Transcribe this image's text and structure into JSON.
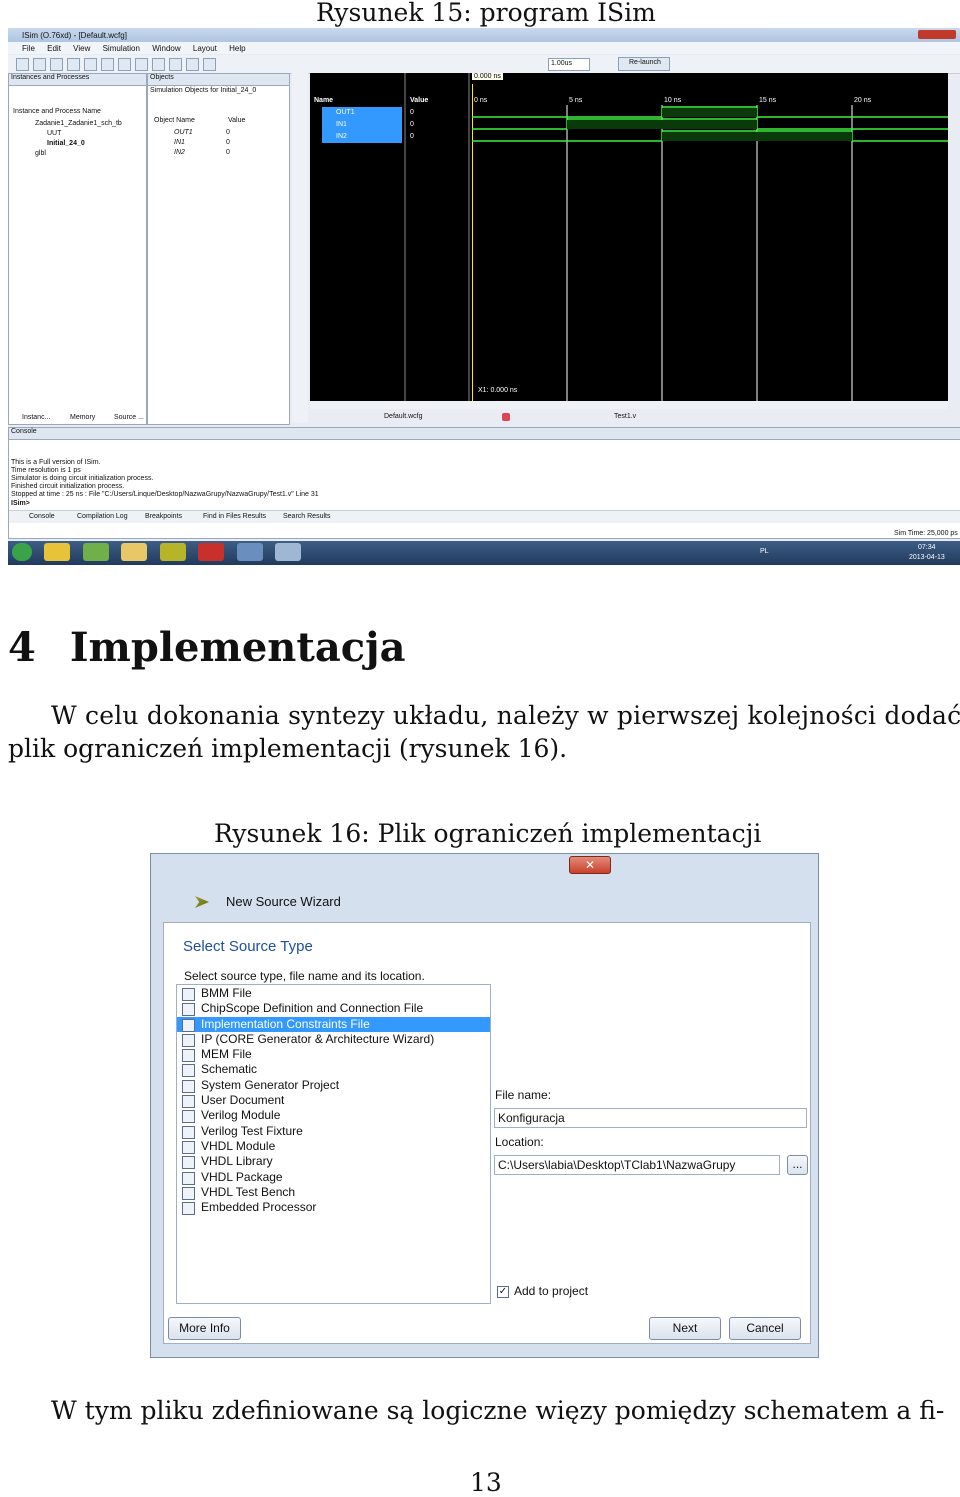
{
  "figure15": {
    "caption": "Rysunek 15: program ISim",
    "window_title": "ISim (O.76xd) - [Default.wcfg]",
    "menu": [
      "File",
      "Edit",
      "View",
      "Simulation",
      "Window",
      "Layout",
      "Help"
    ],
    "toolbar": {
      "time_value": "1.00us",
      "relaunch": "Re-launch"
    },
    "instances_panel": {
      "title": "Instances and Processes",
      "column": "Instance and Process Name",
      "rows": [
        "Zadanie1_Zadanie1_sch_tb",
        "UUT",
        "Initial_24_0",
        "glbl"
      ],
      "tabs": [
        "Instanc...",
        "Memory",
        "Source ..."
      ]
    },
    "objects_panel": {
      "title": "Objects",
      "subtitle": "Simulation Objects for Initial_24_0",
      "columns": [
        "Object Name",
        "Value"
      ],
      "rows": [
        {
          "name": "OUT1",
          "value": "0"
        },
        {
          "name": "IN1",
          "value": "0"
        },
        {
          "name": "IN2",
          "value": "0"
        }
      ]
    },
    "wave_panel": {
      "cursor_time": "0.000 ns",
      "columns": [
        "Name",
        "Value"
      ],
      "signals": [
        {
          "name": "OUT1",
          "value": "0"
        },
        {
          "name": "IN1",
          "value": "0"
        },
        {
          "name": "IN2",
          "value": "0"
        }
      ],
      "ticks": [
        "0 ns",
        "5 ns",
        "10 ns",
        "15 ns",
        "20 ns"
      ],
      "x1": "X1: 0.000 ns",
      "tabs": [
        "Default.wcfg",
        "Test1.v"
      ]
    },
    "console": {
      "title": "Console",
      "lines": [
        "This is a Full version of ISim.",
        "Time resolution is 1 ps",
        "Simulator is doing circuit initialization process.",
        "Finished circuit initialization process.",
        "Stopped at time : 25 ns : File \"C:/Users/Linque/Desktop/NazwaGrupy/NazwaGrupy/Test1.v\" Line 31"
      ],
      "prompt": "ISim>",
      "tabs": [
        "Console",
        "Compilation Log",
        "Breakpoints",
        "Find in Files Results",
        "Search Results"
      ],
      "sim_time": "Sim Time: 25,000 ps"
    },
    "taskbar": {
      "lang": "PL",
      "time": "07:34",
      "date": "2013-04-13"
    }
  },
  "section": {
    "number": "4",
    "title": "Implementacja"
  },
  "paragraph1": {
    "line1": "W celu dokonania syntezy układu, należy w pierwszej kolejności dodać",
    "line2": "plik ograniczeń implementacji (rysunek 16)."
  },
  "figure16": {
    "caption": "Rysunek 16: Plik ograniczeń implementacji",
    "wizard_title": "New Source Wizard",
    "heading": "Select Source Type",
    "instruction": "Select source type, file name and its location.",
    "source_types": [
      "BMM File",
      "ChipScope Definition and Connection File",
      "Implementation Constraints File",
      "IP (CORE Generator & Architecture Wizard)",
      "MEM File",
      "Schematic",
      "System Generator Project",
      "User Document",
      "Verilog Module",
      "Verilog Test Fixture",
      "VHDL Module",
      "VHDL Library",
      "VHDL Package",
      "VHDL Test Bench",
      "Embedded Processor"
    ],
    "selected_index": 2,
    "file_name_label": "File name:",
    "file_name": "Konfiguracja",
    "location_label": "Location:",
    "location": "C:\\Users\\labia\\Desktop\\TClab1\\NazwaGrupy",
    "browse": "...",
    "add_to_project": "Add to project",
    "buttons": {
      "more_info": "More Info",
      "next": "Next",
      "cancel": "Cancel"
    }
  },
  "paragraph2": {
    "line1": "W tym pliku zdefiniowane są logiczne więzy pomiędzy schematem a fi-"
  },
  "page_number": "13"
}
